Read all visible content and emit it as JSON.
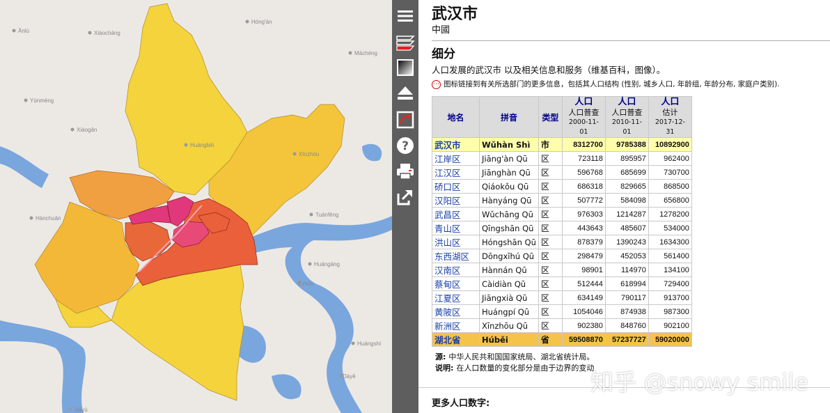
{
  "map": {
    "places": [
      "Ānlù",
      "Xiàochāng",
      "Hóng'ān",
      "Máchéng",
      "Yúnmèng",
      "Xiàogǎn",
      "Huángbēi",
      "Xīnzhōu",
      "Hànchuān",
      "Tuánfēng",
      "Huángāng",
      "Èzhōu",
      "Huángshí",
      "Dàyě",
      "Jiāyú"
    ]
  },
  "toolbar": {
    "items": [
      "menu-icon",
      "layers-icon",
      "gradient-icon",
      "eject-icon",
      "rotate-icon",
      "help-icon",
      "print-icon",
      "export-icon"
    ]
  },
  "header": {
    "title": "武汉市",
    "country": "中國"
  },
  "section": {
    "title": "细分",
    "desc": "人口发展的武汉市 以及相关信息和服务（维基百科，图像）。",
    "note": "图标链接到有关所选部门的更多信息，包括其人口结构 (性别, 城乡人口, 年龄组, 年龄分布, 家庭户类别)."
  },
  "table": {
    "headers": {
      "name": "地名",
      "pinyin": "拼音",
      "type": "类型",
      "pop_label": "人口",
      "census": "人口普查",
      "estimate": "估计",
      "d1": "2000-11-01",
      "d2": "2010-11-01",
      "d3": "2017-12-31"
    },
    "city": {
      "name": "武汉市",
      "pinyin": "Wǔhàn Shì",
      "type": "市",
      "p2000": "8312700",
      "p2010": "9785388",
      "p2017": "10892900"
    },
    "rows": [
      {
        "name": "江岸区",
        "pinyin": "Jiāng'àn Qū",
        "type": "区",
        "p2000": "723118",
        "p2010": "895957",
        "p2017": "962400"
      },
      {
        "name": "江汉区",
        "pinyin": "Jiānghàn Qū",
        "type": "区",
        "p2000": "596768",
        "p2010": "685699",
        "p2017": "730700"
      },
      {
        "name": "硚口区",
        "pinyin": "Qiáokǒu Qū",
        "type": "区",
        "p2000": "686318",
        "p2010": "829665",
        "p2017": "868500"
      },
      {
        "name": "汉阳区",
        "pinyin": "Hànyáng Qū",
        "type": "区",
        "p2000": "507772",
        "p2010": "584098",
        "p2017": "656800"
      },
      {
        "name": "武昌区",
        "pinyin": "Wǔchāng Qū",
        "type": "区",
        "p2000": "976303",
        "p2010": "1214287",
        "p2017": "1278200"
      },
      {
        "name": "青山区",
        "pinyin": "Qīngshān Qū",
        "type": "区",
        "p2000": "443643",
        "p2010": "485607",
        "p2017": "534000"
      },
      {
        "name": "洪山区",
        "pinyin": "Hóngshān Qū",
        "type": "区",
        "p2000": "878379",
        "p2010": "1390243",
        "p2017": "1634300"
      },
      {
        "name": "东西湖区",
        "pinyin": "Dōngxīhú Qū",
        "type": "区",
        "p2000": "298479",
        "p2010": "452053",
        "p2017": "561400"
      },
      {
        "name": "汉南区",
        "pinyin": "Hànnán Qū",
        "type": "区",
        "p2000": "98901",
        "p2010": "114970",
        "p2017": "134100"
      },
      {
        "name": "蔡甸区",
        "pinyin": "Càidiàn Qū",
        "type": "区",
        "p2000": "512444",
        "p2010": "618994",
        "p2017": "729400"
      },
      {
        "name": "江夏区",
        "pinyin": "Jiāngxià Qū",
        "type": "区",
        "p2000": "634149",
        "p2010": "790117",
        "p2017": "913700"
      },
      {
        "name": "黄陂区",
        "pinyin": "Huángpí Qū",
        "type": "区",
        "p2000": "1054046",
        "p2010": "874938",
        "p2017": "987300"
      },
      {
        "name": "新洲区",
        "pinyin": "Xīnzhōu Qū",
        "type": "区",
        "p2000": "902380",
        "p2010": "848760",
        "p2017": "902100"
      }
    ],
    "province": {
      "name": "湖北省",
      "pinyin": "Húběi",
      "type": "省",
      "p2000": "59508870",
      "p2010": "57237727",
      "p2017": "59020000"
    }
  },
  "source": {
    "label": "源:",
    "text": "中华人民共和国国家统局、湖北省统计局。",
    "note_label": "说明:",
    "note_text": "在人口数量的变化部分是由于边界的变动"
  },
  "more": "更多人口数字:",
  "watermark": "知乎 @snowy smile",
  "colors": {
    "yellow": "#f4d33c",
    "gold": "#f4b838",
    "orange": "#f0a040",
    "red_orange": "#e9603a",
    "magenta": "#e0387a",
    "water": "#7aa6de",
    "toolbar": "#5e5e5e"
  }
}
